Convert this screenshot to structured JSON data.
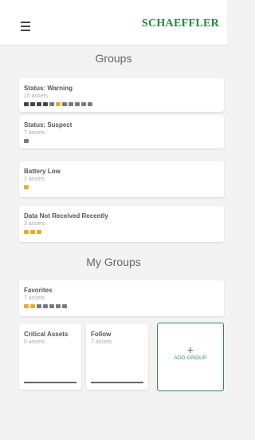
{
  "app": {
    "brand": "SCHAEFFLER"
  },
  "groups_section": {
    "title": "Groups"
  },
  "groups": [
    {
      "title": "Status: Warning",
      "subtitle": "15 assets",
      "icons": [
        "dark",
        "dark",
        "dark",
        "dark",
        "light",
        "yellow",
        "light",
        "light",
        "light",
        "light",
        "light"
      ]
    },
    {
      "title": "Status: Suspect",
      "subtitle": "7 assets",
      "icons": [
        "light"
      ]
    },
    {
      "title": "Battery Low",
      "subtitle": "1 assets",
      "icons": [
        "yellow"
      ]
    },
    {
      "title": "Data Not Received Recently",
      "subtitle": "3 assets",
      "icons": [
        "yellow",
        "yellow",
        "yellow"
      ]
    }
  ],
  "my_groups_section": {
    "title": "My Groups"
  },
  "my_groups": {
    "favorites": {
      "title": "Favorites",
      "subtitle": "7 assets",
      "icons": [
        "yellow",
        "yellow",
        "light",
        "light",
        "light",
        "light",
        "light"
      ]
    },
    "critical": {
      "title": "Critical Assets",
      "subtitle": "0 assets"
    },
    "follow": {
      "title": "Follow",
      "subtitle": "7 assets"
    },
    "add_group": {
      "plus": "+",
      "label": "ADD GROUP"
    }
  },
  "colors": {
    "brand": "#1f8a3a",
    "warning": "#e8b021"
  }
}
